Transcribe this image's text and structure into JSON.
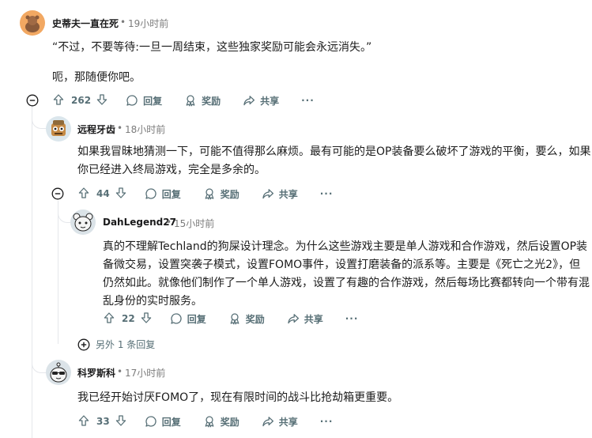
{
  "comments": [
    {
      "username": "史蒂夫一直在死",
      "time": "19小时前",
      "paragraphs": [
        "“不过，不要等待:一旦一周结束，这些独家奖励可能会永远消失。”",
        "呃，那随便你吧。"
      ],
      "votes": "262"
    },
    {
      "username": "远程牙齿",
      "time": "18小时前",
      "text": "如果我冒昧地猜测一下，可能不值得那么麻烦。最有可能的是OP装备要么破坏了游戏的平衡，要么，如果你已经进入终局游戏，完全是多余的。",
      "votes": "44"
    },
    {
      "username": "DahLegend27",
      "time": "15小时前",
      "text": "真的不理解Techland的狗屎设计理念。为什么这些游戏主要是单人游戏和合作游戏，然后设置OP装备微交易，设置突袭子模式，设置FOMO事件，设置打磨装备的派系等。主要是《死亡之光2》，但仍然如此。就像他们制作了一个单人游戏，设置了有趣的合作游戏，然后每场比赛都转向一个带有混乱身份的实时服务。",
      "votes": "22"
    },
    {
      "username": "科罗斯科",
      "time": "17小时前",
      "text": "我已经开始讨厌FOMO了，现在有限时间的战斗比抢劫箱更重要。",
      "votes": "33"
    }
  ],
  "labels": {
    "reply": "回复",
    "award": "奖励",
    "share": "共享",
    "more": "···",
    "separator": "•",
    "more_replies": "另外 1 条回复"
  },
  "colors": {
    "meta": "#576f76",
    "thread_line": "#e5e7eb",
    "text": "#1c1c1c"
  }
}
